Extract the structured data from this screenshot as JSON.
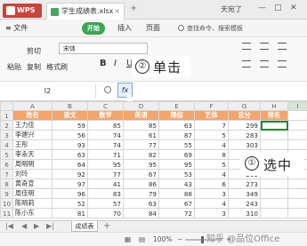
{
  "titlebar": {
    "wps_label": "WPS",
    "file_tab": "学生成绩表.xlsx",
    "new_tab": "+",
    "user_name": "天宛了",
    "controls": [
      "—",
      "□",
      "✕"
    ]
  },
  "menubar": {
    "file": "≡ 文件",
    "start": "开始",
    "insert": "插入",
    "page": "页面",
    "search": "查找命令、搜索模板"
  },
  "ribbon": {
    "paste": "粘贴",
    "cut": "剪切",
    "copy": "复制",
    "format_painter": "格式刷",
    "font_name": "宋体",
    "bold": "B",
    "italic": "I",
    "underline": "U"
  },
  "annotation2": {
    "num": "②",
    "label": "单击"
  },
  "annotation1": {
    "num": "①",
    "label": "选中"
  },
  "formula": {
    "cell_ref": "I2",
    "fx": "fx"
  },
  "columns": [
    "A",
    "B",
    "C",
    "D",
    "E",
    "F",
    "G",
    "H",
    "I"
  ],
  "headers": [
    "姓名",
    "语文",
    "数学",
    "英语",
    "理综",
    "艺体",
    "总分",
    "排名"
  ],
  "rows": [
    [
      "王力佳",
      "59",
      "85",
      "85",
      "63",
      "7",
      "299"
    ],
    [
      "李建兴",
      "56",
      "74",
      "61",
      "87",
      "5",
      "283"
    ],
    [
      "王彤",
      "93",
      "74",
      "77",
      "55",
      "4",
      "303"
    ],
    [
      "李永天",
      "63",
      "71",
      "82",
      "69",
      "8",
      "293"
    ],
    [
      "周明明",
      "64",
      "95",
      "95",
      "95",
      "5",
      "354"
    ],
    [
      "刘玲",
      "92",
      "77",
      "67",
      "53",
      "4",
      "293"
    ],
    [
      "黄奇宣",
      "97",
      "41",
      "86",
      "43",
      "6",
      "273"
    ],
    [
      "周佳明",
      "96",
      "83",
      "79",
      "88",
      "3",
      "349"
    ],
    [
      "陈明莉",
      "52",
      "57",
      "63",
      "67",
      "4",
      "243"
    ],
    [
      "陈小东",
      "81",
      "70",
      "84",
      "72",
      "3",
      "310"
    ]
  ],
  "sheet_tab": "成绩表",
  "status": {
    "zoom": "100%",
    "minus": "−",
    "plus": "+"
  },
  "watermark": "知乎 @品位Office"
}
